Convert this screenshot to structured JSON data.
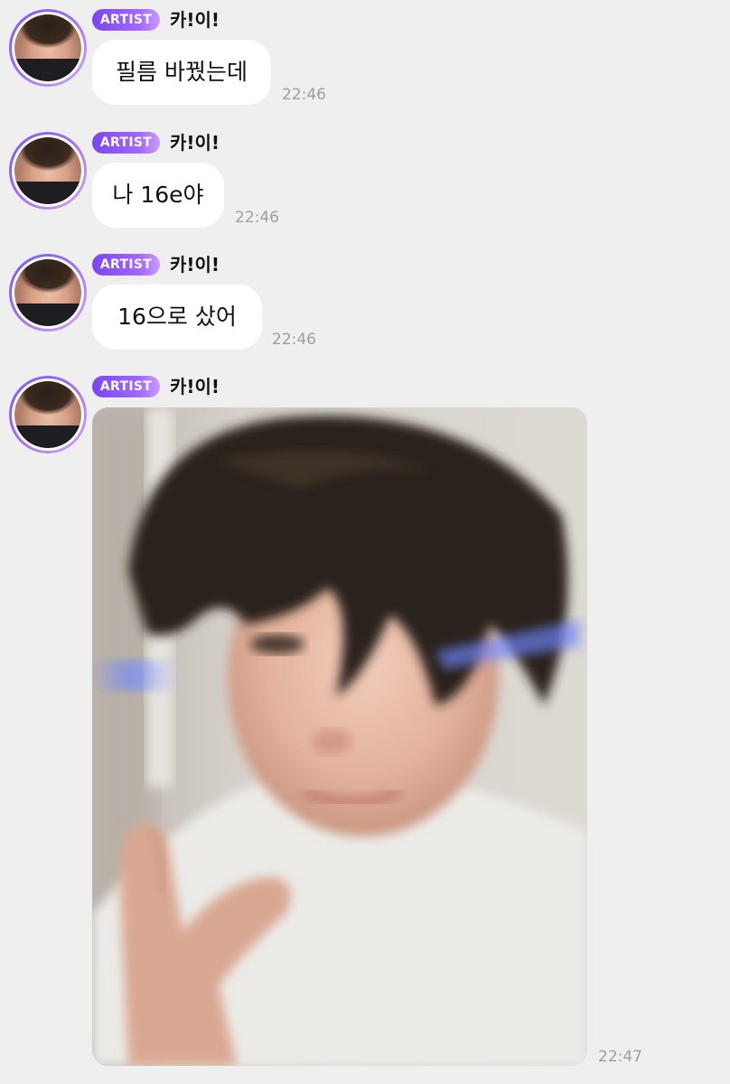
{
  "chat": {
    "artist_badge": "ARTIST",
    "sender_name": "카!이!",
    "messages": [
      {
        "text": "필름 바꿨는데",
        "time": "22:46"
      },
      {
        "text": "나 16e야",
        "time": "22:46"
      },
      {
        "text": "16으로 샀어",
        "time": "22:46"
      }
    ],
    "photo_message": {
      "time": "22:47"
    }
  },
  "colors": {
    "background": "#efeff0",
    "bubble": "#ffffff",
    "badge_start": "#7a46f0",
    "badge_end": "#c99cff",
    "timestamp": "#9d9da3"
  }
}
